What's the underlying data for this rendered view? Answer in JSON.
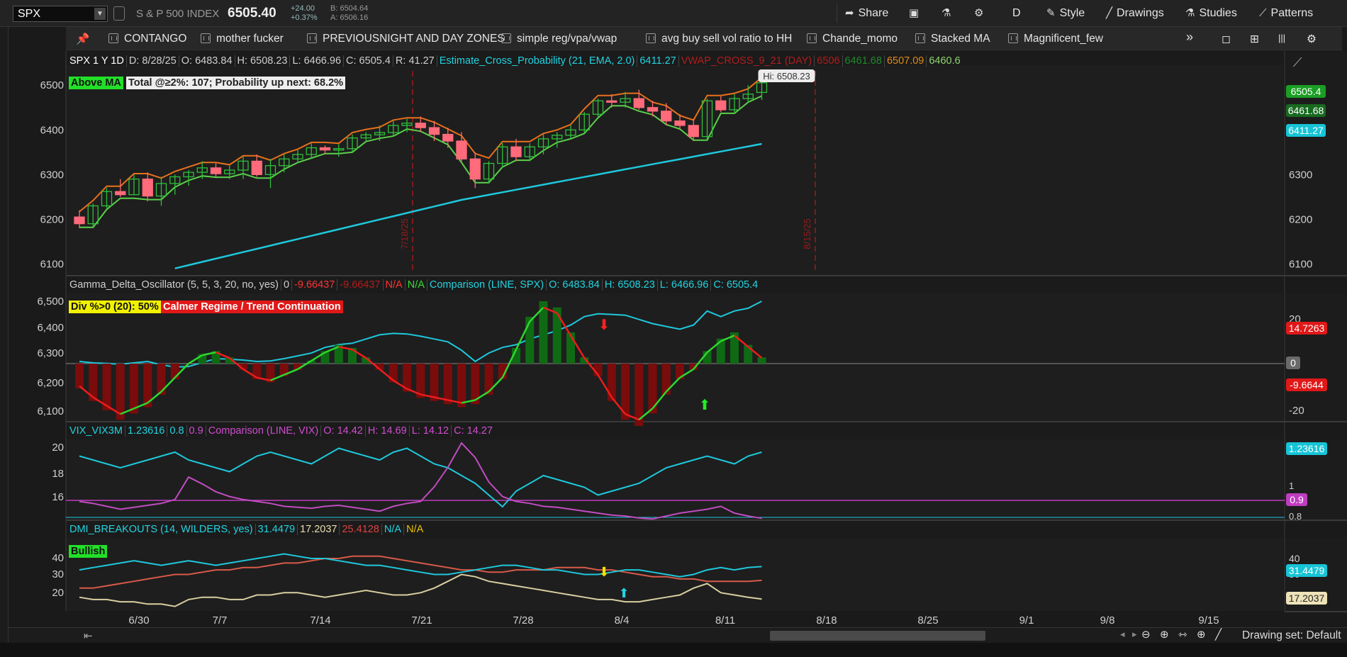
{
  "app": {
    "symbol": "SPX",
    "symbol_name": "S & P 500 INDEX",
    "price": "6505.40",
    "change_abs": "+24.00",
    "change_pct": "+0.37%",
    "bid": "B: 6504.64",
    "ask": "A: 6506.16"
  },
  "toolbar": {
    "share": "Share",
    "timeframe": "D",
    "style": "Style",
    "drawings": "Drawings",
    "studies": "Studies",
    "patterns": "Patterns"
  },
  "studies_bar": {
    "items": [
      "CONTANGO",
      "mother fucker",
      "PREVIOUSNIGHT AND DAY ZONES",
      "simple reg/vpa/vwap",
      "avg buy sell vol ratio to HH",
      "Chande_momo",
      "Stacked MA",
      "Magnificent_few"
    ],
    "more": "»"
  },
  "price_pane": {
    "header": [
      {
        "text": "SPX 1 Y 1D",
        "color": "#ffffff"
      },
      {
        "text": "D: 8/28/25",
        "color": "#cfcfcf"
      },
      {
        "text": "O: 6483.84",
        "color": "#cfcfcf"
      },
      {
        "text": "H: 6508.23",
        "color": "#cfcfcf"
      },
      {
        "text": "L: 6466.96",
        "color": "#cfcfcf"
      },
      {
        "text": "C: 6505.4",
        "color": "#cfcfcf"
      },
      {
        "text": "R: 41.27",
        "color": "#cfcfcf"
      },
      {
        "text": "Estimate_Cross_Probability (21, EMA, 2.0)",
        "color": "#22d3e0"
      },
      {
        "text": "6411.27",
        "color": "#22d3e0"
      },
      {
        "text": "VWAP_CROSS_9_21 (DAY)",
        "color": "#b21c1c"
      },
      {
        "text": "6506",
        "color": "#b21c1c"
      },
      {
        "text": "6461.68",
        "color": "#1f8a2c"
      },
      {
        "text": "6507.09",
        "color": "#e08a1a"
      },
      {
        "text": "6460.6",
        "color": "#8ed66f"
      }
    ],
    "badge_ma": "Above MA",
    "badge_total": "Total @≥2%: 107; Probability up next: 68.2%",
    "hi_label": "Hi: 6508.23",
    "vlines": [
      "7/18/25",
      "8/15/25"
    ],
    "right_labels": [
      {
        "text": "6505.4",
        "bg": "#1a9e24"
      },
      {
        "text": "6461.68",
        "bg": "#176a1f"
      },
      {
        "text": "6411.27",
        "bg": "#16c4d6"
      }
    ],
    "y_ticks": [
      "6500",
      "6400",
      "6300",
      "6200",
      "6100"
    ],
    "y_ticks_right": [
      "6300",
      "6200",
      "6100"
    ]
  },
  "gamma_pane": {
    "header": [
      {
        "text": "Gamma_Delta_Oscillator (5, 5, 3, 20, no, yes)",
        "color": "#cfcfcf"
      },
      {
        "text": "0",
        "color": "#cfcfcf"
      },
      {
        "text": "-9.66437",
        "color": "#ff3333"
      },
      {
        "text": "-9.66437",
        "color": "#b21c1c"
      },
      {
        "text": "N/A",
        "color": "#ff3333"
      },
      {
        "text": "N/A",
        "color": "#33dd33"
      },
      {
        "text": "Comparison (LINE, SPX)",
        "color": "#22d3e0"
      },
      {
        "text": "O: 6483.84",
        "color": "#22d3e0"
      },
      {
        "text": "H: 6508.23",
        "color": "#22d3e0"
      },
      {
        "text": "L: 6466.96",
        "color": "#22d3e0"
      },
      {
        "text": "C: 6505.4",
        "color": "#22d3e0"
      }
    ],
    "badge_div": "Div %>0 (20): 50%",
    "badge_regime": "Calmer Regime / Trend Continuation",
    "y_ticks_left": [
      "6,500",
      "6,400",
      "6,300",
      "6,200",
      "6,100"
    ],
    "y_ticks_right": [
      "20",
      "-20"
    ],
    "right_labels": [
      {
        "text": "14.7263",
        "bg": "#e01818"
      },
      {
        "text": "0",
        "bg": "#6a6a6a"
      },
      {
        "text": "-9.6644",
        "bg": "#e01818"
      }
    ]
  },
  "vix_pane": {
    "header": [
      {
        "text": "VIX_VIX3M",
        "color": "#22d3e0"
      },
      {
        "text": "1.23616",
        "color": "#22d3e0"
      },
      {
        "text": "0.8",
        "color": "#22d3e0"
      },
      {
        "text": "0.9",
        "color": "#d04cd0"
      },
      {
        "text": "Comparison (LINE, VIX)",
        "color": "#d04cd0"
      },
      {
        "text": "O: 14.42",
        "color": "#d04cd0"
      },
      {
        "text": "H: 14.69",
        "color": "#d04cd0"
      },
      {
        "text": "L: 14.12",
        "color": "#d04cd0"
      },
      {
        "text": "C: 14.27",
        "color": "#d04cd0"
      }
    ],
    "y_ticks_left": [
      "20",
      "18",
      "16"
    ],
    "y_ticks_right": [
      "1.2",
      "1",
      "0.8"
    ],
    "right_labels": [
      {
        "text": "1.23616",
        "bg": "#16c4d6"
      },
      {
        "text": "0.9",
        "bg": "#c03cc0"
      }
    ]
  },
  "dmi_pane": {
    "header": [
      {
        "text": "DMI_BREAKOUTS (14, WILDERS, yes)",
        "color": "#22d3e0"
      },
      {
        "text": "31.4479",
        "color": "#22d3e0"
      },
      {
        "text": "17.2037",
        "color": "#e8dfb0"
      },
      {
        "text": "25.4128",
        "color": "#e04040"
      },
      {
        "text": "N/A",
        "color": "#22d3e0"
      },
      {
        "text": "N/A",
        "color": "#e8c000"
      }
    ],
    "badge": "Bullish",
    "y_ticks_left": [
      "40",
      "30",
      "20"
    ],
    "y_ticks_right": [
      "40",
      "30"
    ],
    "right_labels": [
      {
        "text": "31.4479",
        "bg": "#16c4d6"
      },
      {
        "text": "17.2037",
        "bg": "#eee3b8"
      }
    ]
  },
  "x_axis": [
    "6/30",
    "7/7",
    "7/14",
    "7/21",
    "7/28",
    "8/4",
    "8/11",
    "8/18",
    "8/25",
    "9/1",
    "9/8",
    "9/15"
  ],
  "status": {
    "drawing_set": "Drawing set: Default"
  },
  "chart_data": {
    "type": "candlestick",
    "candles": [
      [
        6205,
        6220,
        6180,
        6190
      ],
      [
        6190,
        6235,
        6185,
        6230
      ],
      [
        6230,
        6270,
        6225,
        6262
      ],
      [
        6262,
        6290,
        6250,
        6255
      ],
      [
        6255,
        6300,
        6255,
        6290
      ],
      [
        6290,
        6305,
        6240,
        6252
      ],
      [
        6252,
        6295,
        6230,
        6280
      ],
      [
        6280,
        6300,
        6255,
        6295
      ],
      [
        6295,
        6310,
        6275,
        6305
      ],
      [
        6305,
        6330,
        6290,
        6315
      ],
      [
        6315,
        6325,
        6295,
        6302
      ],
      [
        6302,
        6320,
        6290,
        6310
      ],
      [
        6310,
        6340,
        6290,
        6330
      ],
      [
        6330,
        6345,
        6295,
        6300
      ],
      [
        6300,
        6335,
        6270,
        6320
      ],
      [
        6320,
        6345,
        6305,
        6335
      ],
      [
        6335,
        6355,
        6325,
        6345
      ],
      [
        6345,
        6370,
        6335,
        6360
      ],
      [
        6360,
        6365,
        6345,
        6355
      ],
      [
        6355,
        6368,
        6340,
        6358
      ],
      [
        6358,
        6390,
        6350,
        6382
      ],
      [
        6382,
        6395,
        6375,
        6389
      ],
      [
        6389,
        6410,
        6375,
        6394
      ],
      [
        6394,
        6420,
        6385,
        6410
      ],
      [
        6410,
        6425,
        6395,
        6415
      ],
      [
        6415,
        6430,
        6395,
        6405
      ],
      [
        6405,
        6420,
        6375,
        6390
      ],
      [
        6390,
        6405,
        6360,
        6375
      ],
      [
        6375,
        6395,
        6325,
        6335
      ],
      [
        6335,
        6350,
        6270,
        6290
      ],
      [
        6290,
        6330,
        6280,
        6325
      ],
      [
        6325,
        6370,
        6315,
        6362
      ],
      [
        6362,
        6380,
        6330,
        6340
      ],
      [
        6340,
        6370,
        6330,
        6362
      ],
      [
        6362,
        6390,
        6345,
        6380
      ],
      [
        6380,
        6395,
        6360,
        6388
      ],
      [
        6388,
        6410,
        6380,
        6400
      ],
      [
        6400,
        6440,
        6395,
        6435
      ],
      [
        6435,
        6470,
        6430,
        6465
      ],
      [
        6465,
        6480,
        6450,
        6462
      ],
      [
        6462,
        6485,
        6450,
        6470
      ],
      [
        6470,
        6490,
        6445,
        6450
      ],
      [
        6450,
        6465,
        6430,
        6442
      ],
      [
        6442,
        6460,
        6410,
        6420
      ],
      [
        6420,
        6435,
        6400,
        6410
      ],
      [
        6410,
        6425,
        6375,
        6385
      ],
      [
        6385,
        6470,
        6380,
        6465
      ],
      [
        6465,
        6475,
        6440,
        6445
      ],
      [
        6445,
        6480,
        6440,
        6470
      ],
      [
        6470,
        6500,
        6460,
        6480
      ],
      [
        6483.84,
        6508.23,
        6466.96,
        6505.4
      ]
    ],
    "xlabel_ticks": [
      "6/30",
      "7/7",
      "7/14",
      "7/21",
      "7/28",
      "8/4",
      "8/11",
      "8/18",
      "8/25",
      "9/1",
      "9/8",
      "9/15"
    ],
    "ylim": [
      6080,
      6540
    ],
    "gamma_values": [
      -8,
      -12,
      -15,
      -18,
      -16,
      -14,
      -10,
      -5,
      0,
      3,
      4,
      2,
      -2,
      -5,
      -6,
      -4,
      -2,
      1,
      4,
      6,
      5,
      2,
      -2,
      -6,
      -9,
      -11,
      -12,
      -13,
      -14,
      -13,
      -10,
      -5,
      5,
      15,
      20,
      18,
      10,
      2,
      -4,
      -12,
      -18,
      -20,
      -16,
      -10,
      -5,
      -2,
      4,
      8,
      10,
      6,
      2,
      -4,
      -10
    ],
    "vix_ratio": [
      0.95,
      0.94,
      0.93,
      0.92,
      0.93,
      0.94,
      0.95,
      0.96,
      0.94,
      0.93,
      0.92,
      0.91,
      0.93,
      0.95,
      0.96,
      0.95,
      0.94,
      0.93,
      0.95,
      0.97,
      0.96,
      0.95,
      0.94,
      0.96,
      0.97,
      0.95,
      0.93,
      0.92,
      0.9,
      0.88,
      0.85,
      0.82,
      0.86,
      0.88,
      0.9,
      0.89,
      0.88,
      0.87,
      0.85,
      0.86,
      0.87,
      0.88,
      0.9,
      0.92,
      0.93,
      0.94,
      0.95,
      0.94,
      0.93,
      0.95,
      0.96,
      0.95
    ],
    "vix_close": [
      16.0,
      15.8,
      15.5,
      15.2,
      15.4,
      15.6,
      15.8,
      16.2,
      18.5,
      17.8,
      17.0,
      16.5,
      16.2,
      16.0,
      15.8,
      15.5,
      15.4,
      15.3,
      15.5,
      15.6,
      15.4,
      15.2,
      15.0,
      15.5,
      15.8,
      16.0,
      17.5,
      19.5,
      22.0,
      20.5,
      18.0,
      16.5,
      16.0,
      15.8,
      15.5,
      15.4,
      15.2,
      15.0,
      14.8,
      14.6,
      14.5,
      14.3,
      14.2,
      14.5,
      14.8,
      15.0,
      15.2,
      15.5,
      14.8,
      14.5,
      14.27
    ],
    "dmi_adx": [
      30,
      31,
      32,
      33,
      34,
      33,
      32,
      33,
      34,
      33,
      32,
      33,
      34,
      35,
      36,
      37,
      36,
      35,
      35,
      34,
      33,
      32,
      32,
      31,
      30,
      29,
      28,
      28,
      29,
      30,
      31,
      32,
      32,
      31,
      30,
      30,
      29,
      28,
      28,
      29,
      30,
      30,
      29,
      28,
      27,
      28,
      30,
      31,
      30,
      31,
      31.45
    ],
    "dmi_plus": [
      18,
      17,
      17,
      16,
      16,
      15,
      15,
      14,
      17,
      18,
      18,
      17,
      17,
      19,
      19,
      20,
      20,
      19,
      18,
      19,
      20,
      21,
      20,
      19,
      19,
      20,
      22,
      25,
      28,
      27,
      25,
      24,
      23,
      22,
      21,
      20,
      19,
      18,
      17,
      17,
      16,
      16,
      17,
      18,
      19,
      22,
      24,
      20,
      19,
      18,
      17.2
    ],
    "dmi_minus": [
      22,
      22,
      23,
      24,
      25,
      26,
      27,
      28,
      28,
      29,
      30,
      30,
      31,
      31,
      32,
      33,
      33,
      34,
      35,
      35,
      36,
      36,
      36,
      35,
      34,
      33,
      32,
      31,
      30,
      30,
      29,
      29,
      30,
      30,
      30,
      31,
      31,
      31,
      30,
      30,
      29,
      28,
      27,
      27,
      26,
      26,
      25,
      25,
      25,
      25,
      25.4
    ]
  }
}
